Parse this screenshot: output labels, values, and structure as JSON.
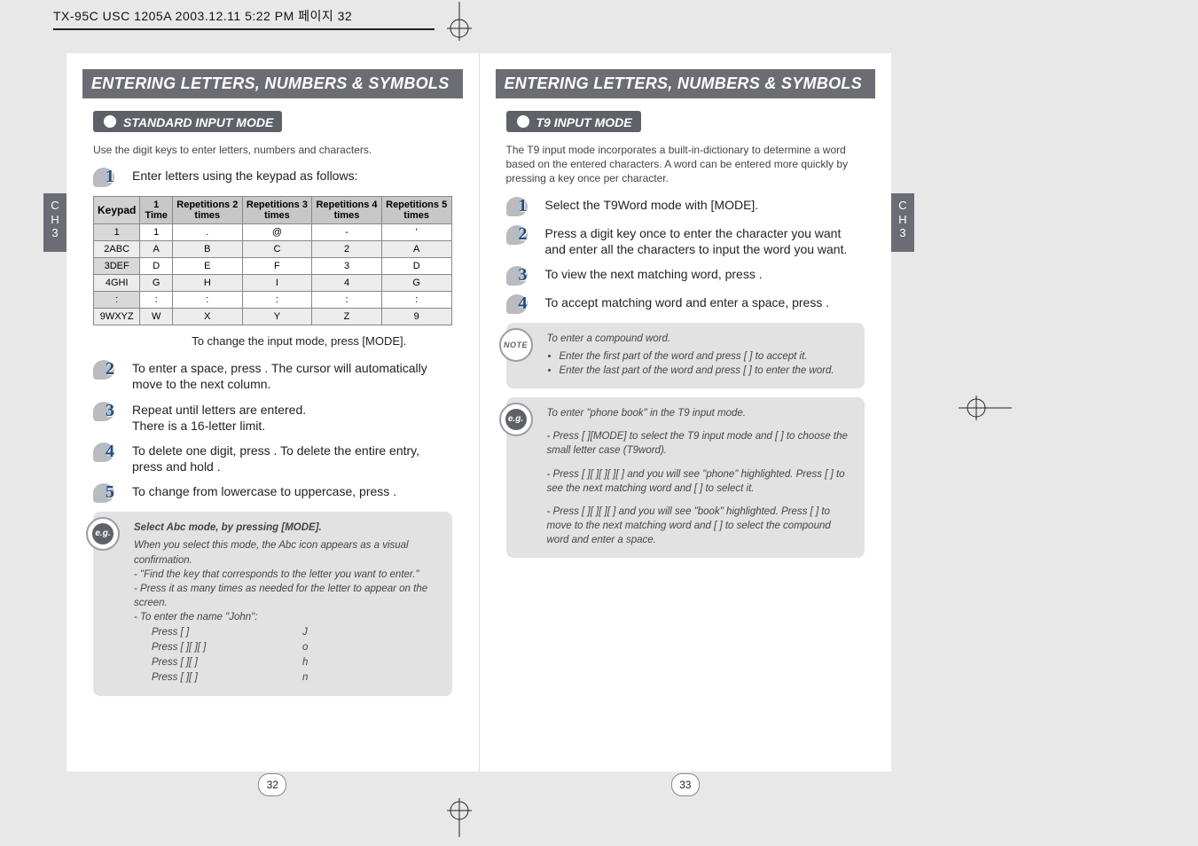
{
  "doc_header": "TX-95C USC 1205A  2003.12.11 5:22 PM  페이지 32",
  "spread_title": "ENTERING LETTERS, NUMBERS & SYMBOLS",
  "side_tab": "C\nH\n3",
  "left_page": {
    "sub_header": "STANDARD INPUT MODE",
    "intro": "Use the digit keys to enter letters, numbers and characters.",
    "step1": "Enter letters using the keypad as follows:",
    "table_headers": [
      "Keypad",
      "1\nTime",
      "Repetitions\n2 times",
      "Repetitions\n3 times",
      "Repetitions\n4 times",
      "Repetitions\n5 times"
    ],
    "table_rows": [
      [
        "1",
        "1",
        ".",
        "@",
        "-",
        "'"
      ],
      [
        "2ABC",
        "A",
        "B",
        "C",
        "2",
        "A"
      ],
      [
        "3DEF",
        "D",
        "E",
        "F",
        "3",
        "D"
      ],
      [
        "4GHI",
        "G",
        "H",
        "I",
        "4",
        "G"
      ],
      [
        ":",
        ":",
        ":",
        ":",
        ":",
        ":"
      ],
      [
        "9WXYZ",
        "W",
        "X",
        "Y",
        "Z",
        "9"
      ]
    ],
    "mode_line": "To change the input mode, press       [MODE].",
    "step2": "To enter a space, press       . The cursor will automatically move to the next column.",
    "step3": "Repeat until letters are entered.\nThere is a 16-letter limit.",
    "step4": "To delete one digit, press       . To delete the entire entry, press and hold       .",
    "step5": "To change from lowercase to uppercase, press       .",
    "eg": {
      "title": "Select Abc mode, by pressing       [MODE].",
      "para": "When you select this mode, the Abc icon appears as a visual confirmation.",
      "lines": [
        "- \"Find the key that corresponds to the letter you want to enter.\"",
        "- Press it as many times as needed for the letter to appear on the screen.",
        "- To enter the name \"John\":"
      ],
      "rows": [
        {
          "l": "Press [    ]",
          "r": "J"
        },
        {
          "l": "Press [    ][    ][    ]",
          "r": "o"
        },
        {
          "l": "Press [    ][    ]",
          "r": "h"
        },
        {
          "l": "Press [    ][    ]",
          "r": "n"
        }
      ]
    },
    "pagenum": "32"
  },
  "right_page": {
    "sub_header": "T9 INPUT MODE",
    "intro": "The T9 input mode incorporates a built-in-dictionary to determine a word based on the entered characters. A word can be entered more quickly by pressing a key once per character.",
    "step1": "Select the T9Word mode with       [MODE].",
    "step2": "Press a digit key once to enter the character you want and enter all the characters to input the word you want.",
    "step3": "To view the next matching word, press       .",
    "step4": "To accept matching word and enter a space, press       .",
    "note": {
      "title": "To enter a compound word.",
      "items": [
        "Enter the first part of the word and press [     ] to accept it.",
        "Enter the last part of the word and press [     ] to enter the word."
      ]
    },
    "eg": {
      "title": "To enter \"phone book\" in the T9 input mode.",
      "paras": [
        "- Press [     ][MODE] to select the T9 input mode and [     ] to choose the small letter case (T9word).",
        "- Press [     ][     ][     ][     ][     ] and you will see \"phone\" highlighted. Press [     ] to see the next matching word and [     ] to select it.",
        "- Press [     ][     ][     ][     ] and you will see \"book\" highlighted. Press [     ] to move to the next matching word and [     ] to select the compound word and enter a space."
      ]
    },
    "pagenum": "33"
  }
}
